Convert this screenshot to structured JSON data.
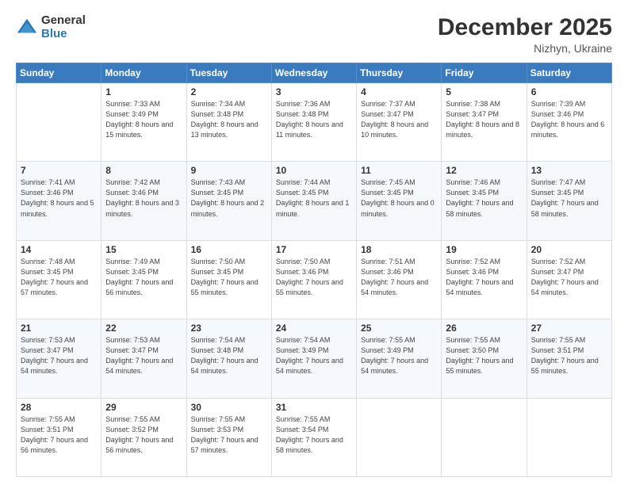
{
  "logo": {
    "general": "General",
    "blue": "Blue"
  },
  "header": {
    "month": "December 2025",
    "location": "Nizhyn, Ukraine"
  },
  "days_of_week": [
    "Sunday",
    "Monday",
    "Tuesday",
    "Wednesday",
    "Thursday",
    "Friday",
    "Saturday"
  ],
  "weeks": [
    [
      {
        "day": "",
        "sunrise": "",
        "sunset": "",
        "daylight": ""
      },
      {
        "day": "1",
        "sunrise": "Sunrise: 7:33 AM",
        "sunset": "Sunset: 3:49 PM",
        "daylight": "Daylight: 8 hours and 15 minutes."
      },
      {
        "day": "2",
        "sunrise": "Sunrise: 7:34 AM",
        "sunset": "Sunset: 3:48 PM",
        "daylight": "Daylight: 8 hours and 13 minutes."
      },
      {
        "day": "3",
        "sunrise": "Sunrise: 7:36 AM",
        "sunset": "Sunset: 3:48 PM",
        "daylight": "Daylight: 8 hours and 11 minutes."
      },
      {
        "day": "4",
        "sunrise": "Sunrise: 7:37 AM",
        "sunset": "Sunset: 3:47 PM",
        "daylight": "Daylight: 8 hours and 10 minutes."
      },
      {
        "day": "5",
        "sunrise": "Sunrise: 7:38 AM",
        "sunset": "Sunset: 3:47 PM",
        "daylight": "Daylight: 8 hours and 8 minutes."
      },
      {
        "day": "6",
        "sunrise": "Sunrise: 7:39 AM",
        "sunset": "Sunset: 3:46 PM",
        "daylight": "Daylight: 8 hours and 6 minutes."
      }
    ],
    [
      {
        "day": "7",
        "sunrise": "Sunrise: 7:41 AM",
        "sunset": "Sunset: 3:46 PM",
        "daylight": "Daylight: 8 hours and 5 minutes."
      },
      {
        "day": "8",
        "sunrise": "Sunrise: 7:42 AM",
        "sunset": "Sunset: 3:46 PM",
        "daylight": "Daylight: 8 hours and 3 minutes."
      },
      {
        "day": "9",
        "sunrise": "Sunrise: 7:43 AM",
        "sunset": "Sunset: 3:45 PM",
        "daylight": "Daylight: 8 hours and 2 minutes."
      },
      {
        "day": "10",
        "sunrise": "Sunrise: 7:44 AM",
        "sunset": "Sunset: 3:45 PM",
        "daylight": "Daylight: 8 hours and 1 minute."
      },
      {
        "day": "11",
        "sunrise": "Sunrise: 7:45 AM",
        "sunset": "Sunset: 3:45 PM",
        "daylight": "Daylight: 8 hours and 0 minutes."
      },
      {
        "day": "12",
        "sunrise": "Sunrise: 7:46 AM",
        "sunset": "Sunset: 3:45 PM",
        "daylight": "Daylight: 7 hours and 58 minutes."
      },
      {
        "day": "13",
        "sunrise": "Sunrise: 7:47 AM",
        "sunset": "Sunset: 3:45 PM",
        "daylight": "Daylight: 7 hours and 58 minutes."
      }
    ],
    [
      {
        "day": "14",
        "sunrise": "Sunrise: 7:48 AM",
        "sunset": "Sunset: 3:45 PM",
        "daylight": "Daylight: 7 hours and 57 minutes."
      },
      {
        "day": "15",
        "sunrise": "Sunrise: 7:49 AM",
        "sunset": "Sunset: 3:45 PM",
        "daylight": "Daylight: 7 hours and 56 minutes."
      },
      {
        "day": "16",
        "sunrise": "Sunrise: 7:50 AM",
        "sunset": "Sunset: 3:45 PM",
        "daylight": "Daylight: 7 hours and 55 minutes."
      },
      {
        "day": "17",
        "sunrise": "Sunrise: 7:50 AM",
        "sunset": "Sunset: 3:46 PM",
        "daylight": "Daylight: 7 hours and 55 minutes."
      },
      {
        "day": "18",
        "sunrise": "Sunrise: 7:51 AM",
        "sunset": "Sunset: 3:46 PM",
        "daylight": "Daylight: 7 hours and 54 minutes."
      },
      {
        "day": "19",
        "sunrise": "Sunrise: 7:52 AM",
        "sunset": "Sunset: 3:46 PM",
        "daylight": "Daylight: 7 hours and 54 minutes."
      },
      {
        "day": "20",
        "sunrise": "Sunrise: 7:52 AM",
        "sunset": "Sunset: 3:47 PM",
        "daylight": "Daylight: 7 hours and 54 minutes."
      }
    ],
    [
      {
        "day": "21",
        "sunrise": "Sunrise: 7:53 AM",
        "sunset": "Sunset: 3:47 PM",
        "daylight": "Daylight: 7 hours and 54 minutes."
      },
      {
        "day": "22",
        "sunrise": "Sunrise: 7:53 AM",
        "sunset": "Sunset: 3:47 PM",
        "daylight": "Daylight: 7 hours and 54 minutes."
      },
      {
        "day": "23",
        "sunrise": "Sunrise: 7:54 AM",
        "sunset": "Sunset: 3:48 PM",
        "daylight": "Daylight: 7 hours and 54 minutes."
      },
      {
        "day": "24",
        "sunrise": "Sunrise: 7:54 AM",
        "sunset": "Sunset: 3:49 PM",
        "daylight": "Daylight: 7 hours and 54 minutes."
      },
      {
        "day": "25",
        "sunrise": "Sunrise: 7:55 AM",
        "sunset": "Sunset: 3:49 PM",
        "daylight": "Daylight: 7 hours and 54 minutes."
      },
      {
        "day": "26",
        "sunrise": "Sunrise: 7:55 AM",
        "sunset": "Sunset: 3:50 PM",
        "daylight": "Daylight: 7 hours and 55 minutes."
      },
      {
        "day": "27",
        "sunrise": "Sunrise: 7:55 AM",
        "sunset": "Sunset: 3:51 PM",
        "daylight": "Daylight: 7 hours and 55 minutes."
      }
    ],
    [
      {
        "day": "28",
        "sunrise": "Sunrise: 7:55 AM",
        "sunset": "Sunset: 3:51 PM",
        "daylight": "Daylight: 7 hours and 56 minutes."
      },
      {
        "day": "29",
        "sunrise": "Sunrise: 7:55 AM",
        "sunset": "Sunset: 3:52 PM",
        "daylight": "Daylight: 7 hours and 56 minutes."
      },
      {
        "day": "30",
        "sunrise": "Sunrise: 7:55 AM",
        "sunset": "Sunset: 3:53 PM",
        "daylight": "Daylight: 7 hours and 57 minutes."
      },
      {
        "day": "31",
        "sunrise": "Sunrise: 7:55 AM",
        "sunset": "Sunset: 3:54 PM",
        "daylight": "Daylight: 7 hours and 58 minutes."
      },
      {
        "day": "",
        "sunrise": "",
        "sunset": "",
        "daylight": ""
      },
      {
        "day": "",
        "sunrise": "",
        "sunset": "",
        "daylight": ""
      },
      {
        "day": "",
        "sunrise": "",
        "sunset": "",
        "daylight": ""
      }
    ]
  ]
}
